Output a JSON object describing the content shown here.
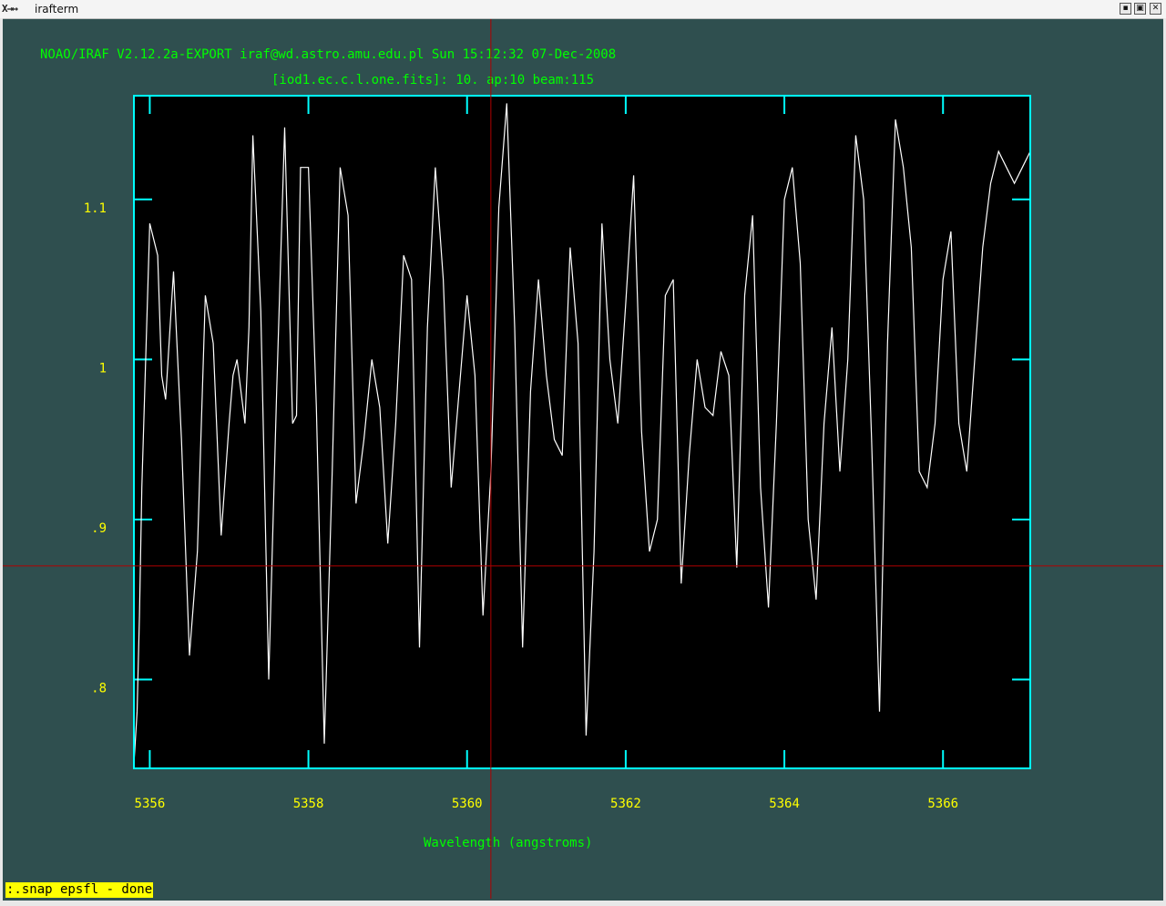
{
  "window": {
    "title": "irafterm",
    "wm_icon": "X→↦"
  },
  "header": {
    "banner": "NOAO/IRAF V2.12.2a-EXPORT iraf@wd.astro.amu.edu.pl Sun 15:12:32 07-Dec-2008",
    "subtitle": "[iod1.ec.c.l.one.fits]:  10. ap:10 beam:115"
  },
  "status_line": ":.snap epsfl -  done",
  "colors": {
    "background": "#2f4f4f",
    "frame": "#00ffff",
    "plot_background": "#000000",
    "spectrum": "#ffffff",
    "tick_labels": "#ffff00",
    "header_text": "#00ff00",
    "cursor": "#b00000",
    "status_bg": "#ffff00"
  },
  "chart_data": {
    "type": "line",
    "title": "[iod1.ec.c.l.one.fits]:  10. ap:10 beam:115",
    "xlabel": "Wavelength (angstroms)",
    "ylabel": "",
    "xlim": [
      5355.8,
      5367.1
    ],
    "ylim": [
      0.7445,
      1.1648
    ],
    "xticks": [
      5356,
      5358,
      5360,
      5362,
      5364,
      5366
    ],
    "xtick_labels": [
      "5356",
      "5358",
      "5360",
      "5362",
      "5364",
      "5366"
    ],
    "yticks": [
      0.8,
      0.9,
      1.0,
      1.1
    ],
    "ytick_labels": [
      ".8",
      ".9",
      "1",
      "1.1"
    ],
    "grid": false,
    "cursor": {
      "x": 5360.3,
      "y": 0.871
    },
    "series": [
      {
        "x": [
          5355.8,
          5355.84,
          5355.87,
          5355.9,
          5356.0,
          5356.1,
          5356.15,
          5356.2,
          5356.3,
          5356.4,
          5356.5,
          5356.6,
          5356.7,
          5356.8,
          5356.9,
          5357.0,
          5357.05,
          5357.1,
          5357.2,
          5357.25,
          5357.3,
          5357.4,
          5357.5,
          5357.6,
          5357.7,
          5357.8,
          5357.85,
          5357.9,
          5358.0,
          5358.1,
          5358.2,
          5358.3,
          5358.4,
          5358.5,
          5358.6,
          5358.7,
          5358.8,
          5358.9,
          5359.0,
          5359.1,
          5359.2,
          5359.3,
          5359.4,
          5359.5,
          5359.6,
          5359.7,
          5359.8,
          5359.9,
          5360.0,
          5360.1,
          5360.2,
          5360.3,
          5360.4,
          5360.5,
          5360.6,
          5360.7,
          5360.8,
          5360.9,
          5361.0,
          5361.1,
          5361.2,
          5361.3,
          5361.4,
          5361.5,
          5361.6,
          5361.7,
          5361.8,
          5361.9,
          5362.0,
          5362.1,
          5362.2,
          5362.3,
          5362.4,
          5362.5,
          5362.6,
          5362.7,
          5362.8,
          5362.9,
          5363.0,
          5363.1,
          5363.2,
          5363.3,
          5363.4,
          5363.5,
          5363.6,
          5363.7,
          5363.8,
          5363.9,
          5364.0,
          5364.1,
          5364.2,
          5364.3,
          5364.4,
          5364.5,
          5364.6,
          5364.7,
          5364.8,
          5364.9,
          5365.0,
          5365.1,
          5365.2,
          5365.3,
          5365.4,
          5365.5,
          5365.6,
          5365.7,
          5365.8,
          5365.9,
          5366.0,
          5366.1,
          5366.2,
          5366.3,
          5366.4,
          5366.5,
          5366.6,
          5366.7,
          5366.8,
          5366.9,
          5367.0,
          5367.1
        ],
        "values": [
          0.747,
          0.78,
          0.84,
          0.92,
          1.085,
          1.065,
          0.99,
          0.975,
          1.055,
          0.95,
          0.815,
          0.88,
          1.04,
          1.01,
          0.89,
          0.96,
          0.99,
          1.0,
          0.96,
          1.02,
          1.14,
          1.03,
          0.8,
          0.98,
          1.145,
          0.96,
          0.965,
          1.12,
          1.12,
          0.97,
          0.76,
          0.93,
          1.12,
          1.09,
          0.91,
          0.95,
          1.0,
          0.97,
          0.885,
          0.96,
          1.065,
          1.05,
          0.82,
          1.02,
          1.12,
          1.05,
          0.92,
          0.98,
          1.04,
          0.99,
          0.84,
          0.93,
          1.095,
          1.16,
          1.02,
          0.82,
          0.98,
          1.05,
          0.99,
          0.95,
          0.94,
          1.07,
          1.01,
          0.765,
          0.88,
          1.085,
          1.0,
          0.96,
          1.035,
          1.115,
          0.955,
          0.88,
          0.9,
          1.04,
          1.05,
          0.86,
          0.94,
          1.0,
          0.97,
          0.965,
          1.005,
          0.99,
          0.87,
          1.04,
          1.09,
          0.92,
          0.845,
          0.96,
          1.1,
          1.12,
          1.06,
          0.9,
          0.85,
          0.96,
          1.02,
          0.93,
          1.0,
          1.14,
          1.1,
          0.95,
          0.78,
          1.01,
          1.15,
          1.12,
          1.07,
          0.93,
          0.92,
          0.96,
          1.05,
          1.08,
          0.96,
          0.93,
          1.0,
          1.07,
          1.11,
          1.13,
          1.12,
          1.11,
          1.12,
          1.13
        ]
      }
    ]
  }
}
